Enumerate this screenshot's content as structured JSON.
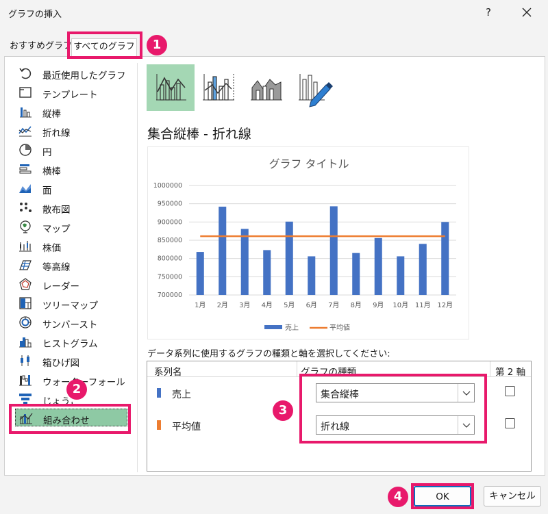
{
  "dialog": {
    "title": "グラフの挿入",
    "help": "?",
    "close": "✕"
  },
  "tabs": {
    "recommended": "おすすめグラフ",
    "all": "すべてのグラフ"
  },
  "sidebar": {
    "items": [
      {
        "label": "最近使用したグラフ",
        "icon": "recent-icon"
      },
      {
        "label": "テンプレート",
        "icon": "template-icon"
      },
      {
        "label": "縦棒",
        "icon": "column-chart-icon"
      },
      {
        "label": "折れ線",
        "icon": "line-chart-icon"
      },
      {
        "label": "円",
        "icon": "pie-chart-icon"
      },
      {
        "label": "横棒",
        "icon": "bar-chart-icon"
      },
      {
        "label": "面",
        "icon": "area-chart-icon"
      },
      {
        "label": "散布図",
        "icon": "scatter-chart-icon"
      },
      {
        "label": "マップ",
        "icon": "map-chart-icon"
      },
      {
        "label": "株価",
        "icon": "stock-chart-icon"
      },
      {
        "label": "等高線",
        "icon": "surface-chart-icon"
      },
      {
        "label": "レーダー",
        "icon": "radar-chart-icon"
      },
      {
        "label": "ツリーマップ",
        "icon": "treemap-icon"
      },
      {
        "label": "サンバースト",
        "icon": "sunburst-icon"
      },
      {
        "label": "ヒストグラム",
        "icon": "histogram-icon"
      },
      {
        "label": "箱ひげ図",
        "icon": "box-whisker-icon"
      },
      {
        "label": "ウォーターフォール",
        "icon": "waterfall-icon"
      },
      {
        "label": "じょうご",
        "icon": "funnel-icon"
      },
      {
        "label": "組み合わせ",
        "icon": "combo-chart-icon"
      }
    ]
  },
  "chart_type_title": "集合縦棒 - 折れ線",
  "chart_data": {
    "type": "bar",
    "title": "グラフ タイトル",
    "categories": [
      "1月",
      "2月",
      "3月",
      "4月",
      "5月",
      "6月",
      "7月",
      "8月",
      "9月",
      "10月",
      "11月",
      "12月"
    ],
    "series": [
      {
        "name": "売上",
        "type": "bar",
        "color": "#4472c4",
        "values": [
          818000,
          942000,
          881000,
          823000,
          901000,
          806000,
          943000,
          815000,
          856000,
          806000,
          840000,
          900000
        ]
      },
      {
        "name": "平均値",
        "type": "line",
        "color": "#ed7d31",
        "values": [
          861000,
          861000,
          861000,
          861000,
          861000,
          861000,
          861000,
          861000,
          861000,
          861000,
          861000,
          861000
        ]
      }
    ],
    "y_ticks": [
      "1000000",
      "950000",
      "900000",
      "850000",
      "800000",
      "750000",
      "700000"
    ],
    "ylim": [
      700000,
      1000000
    ],
    "grid": true,
    "legend_position": "bottom"
  },
  "series_caption": "データ系列に使用するグラフの種類と軸を選択してください:",
  "series_table": {
    "headers": {
      "name": "系列名",
      "type": "グラフの種類",
      "axis": "第 2 軸"
    },
    "rows": [
      {
        "name": "売上",
        "color": "#4472c4",
        "type": "集合縦棒",
        "secondary": false
      },
      {
        "name": "平均値",
        "color": "#ed7d31",
        "type": "折れ線",
        "secondary": false
      }
    ]
  },
  "buttons": {
    "ok": "OK",
    "cancel": "キャンセル"
  },
  "annotations": {
    "badge1": "1",
    "badge2": "2",
    "badge3": "3",
    "badge4": "4",
    "color": "#e8196b"
  }
}
